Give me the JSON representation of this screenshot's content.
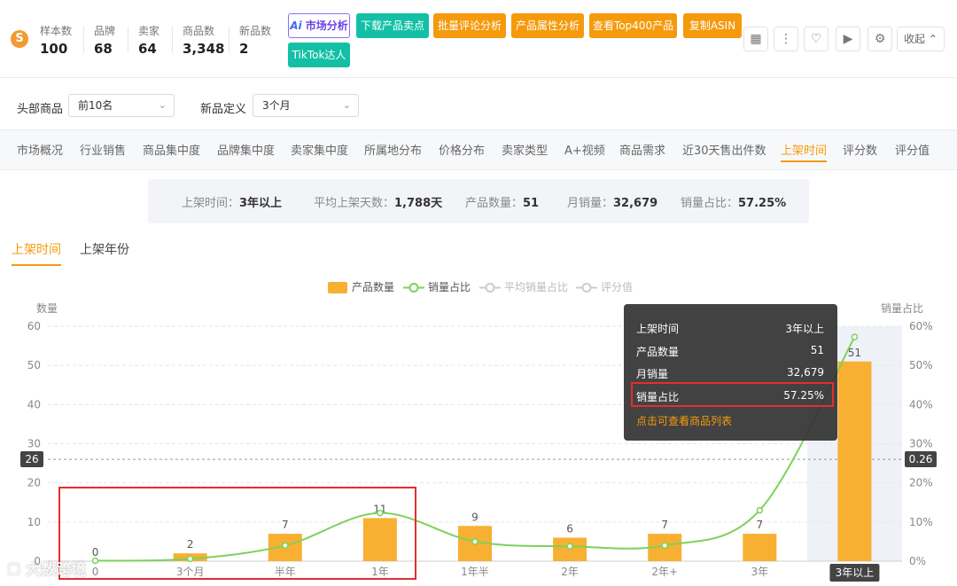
{
  "header": {
    "stats": [
      {
        "label": "样本数",
        "value": "100"
      },
      {
        "label": "品牌",
        "value": "68"
      },
      {
        "label": "卖家",
        "value": "64"
      },
      {
        "label": "商品数",
        "value": "3,348"
      },
      {
        "label": "新品数",
        "value": "2"
      }
    ],
    "buttons": {
      "market_ai_prefix": "Ai",
      "market": "市场分析",
      "download": "下载产品卖点",
      "review": "批量评论分析",
      "attr": "产品属性分析",
      "top400": "查看Top400产品",
      "asin": "复制ASIN",
      "tiktok": "TikTok达人"
    },
    "collapse_label": "收起"
  },
  "filters": {
    "head_label": "头部商品",
    "head_value": "前10名",
    "new_label": "新品定义",
    "new_value": "3个月"
  },
  "tabs": [
    "市场概况",
    "行业销售",
    "商品集中度",
    "品牌集中度",
    "卖家集中度",
    "所属地分布",
    "价格分布",
    "卖家类型",
    "A+视频",
    "商品需求",
    "近30天售出件数",
    "上架时间",
    "评分数",
    "评分值"
  ],
  "active_tab": "上架时间",
  "summary": {
    "time_label": "上架时间：",
    "time_value": "3年以上",
    "avg_label": "平均上架天数：",
    "avg_value": "1,788天",
    "count_label": "产品数量：",
    "count_value": "51",
    "sales_label": "月销量：",
    "sales_value": "32,679",
    "share_label": "销量占比：",
    "share_value": "57.25%"
  },
  "subtabs": [
    "上架时间",
    "上架年份"
  ],
  "tooltip": {
    "rows": [
      {
        "k": "上架时间",
        "v": "3年以上"
      },
      {
        "k": "产品数量",
        "v": "51"
      },
      {
        "k": "月销量",
        "v": "32,679"
      },
      {
        "k": "销量占比",
        "v": "57.25%"
      }
    ],
    "link": "点击可查看商品列表"
  },
  "watermark": "大数跨境",
  "colors": {
    "accent": "#f59a0c",
    "bar": "#f7b032",
    "line": "#7ed15a",
    "highlight": "#e52d2d"
  },
  "chart_data": {
    "type": "bar",
    "categories": [
      "0",
      "3个月",
      "半年",
      "1年",
      "1年半",
      "2年",
      "2年+",
      "3年",
      "3年以上"
    ],
    "series": [
      {
        "name": "产品数量",
        "type": "bar",
        "axis": "left",
        "values": [
          0,
          2,
          7,
          11,
          9,
          6,
          7,
          7,
          51
        ]
      },
      {
        "name": "销量占比",
        "type": "line",
        "axis": "right",
        "values": [
          0.1,
          0.6,
          4,
          12.3,
          5,
          3.8,
          4,
          13,
          57.25
        ]
      },
      {
        "name": "平均销量占比",
        "type": "line",
        "axis": "right",
        "values": []
      },
      {
        "name": "评分值",
        "type": "line",
        "axis": "right",
        "values": []
      }
    ],
    "ylabel_left": "数量",
    "ylabel_right": "销量占比",
    "ylim_left": [
      0,
      60
    ],
    "yticks_left": [
      "0",
      "10",
      "20",
      "30",
      "40",
      "50",
      "60"
    ],
    "ylim_right": [
      0,
      60
    ],
    "yticks_right": [
      "0%",
      "10%",
      "20%",
      "30%",
      "40%",
      "50%",
      "60%"
    ],
    "reference_line": {
      "value": 26,
      "left_label": "26",
      "right_label": "0.26"
    },
    "highlight_category": "3年以上",
    "legend_position": "top-center",
    "grid": true
  }
}
